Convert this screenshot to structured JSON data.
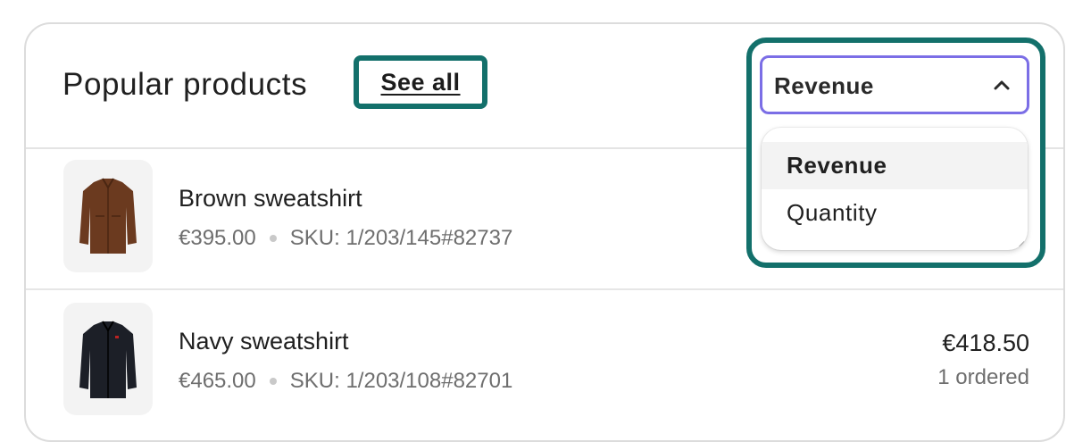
{
  "header": {
    "title": "Popular products",
    "see_all_label": "See all"
  },
  "sort": {
    "selected": "Revenue",
    "options": [
      "Revenue",
      "Quantity"
    ]
  },
  "products": [
    {
      "name": "Brown sweatshirt",
      "price": "€395.00",
      "sku": "SKU: 1/203/145#82737",
      "revenue": "",
      "ordered": "",
      "image": "brown-jacket-image"
    },
    {
      "name": "Navy sweatshirt",
      "price": "€465.00",
      "sku": "SKU: 1/203/108#82701",
      "revenue": "€418.50",
      "ordered": "1 ordered",
      "image": "navy-jacket-image"
    }
  ],
  "colors": {
    "highlight": "#13706b",
    "select_border": "#7b6ee6"
  }
}
